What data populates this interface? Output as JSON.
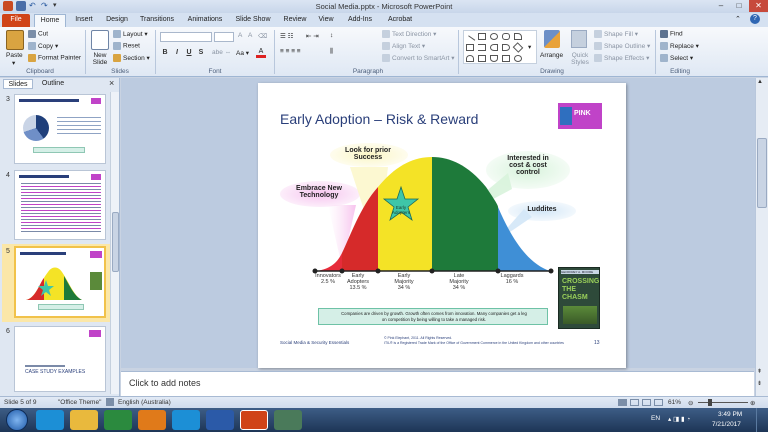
{
  "window": {
    "title": "Social Media.pptx - Microsoft PowerPoint"
  },
  "tabs": [
    "File",
    "Home",
    "Insert",
    "Design",
    "Transitions",
    "Animations",
    "Slide Show",
    "Review",
    "View",
    "Add-Ins",
    "Acrobat"
  ],
  "ribbon": {
    "clipboard": {
      "paste": "Paste",
      "cut": "Cut",
      "copy": "Copy",
      "format_painter": "Format Painter",
      "label": "Clipboard"
    },
    "slides": {
      "new_slide": "New Slide",
      "layout": "Layout",
      "reset": "Reset",
      "section": "Section",
      "label": "Slides"
    },
    "font": {
      "label": "Font",
      "bold": "B",
      "italic": "I",
      "underline": "U",
      "strike": "S"
    },
    "paragraph": {
      "text_direction": "Text Direction",
      "align_text": "Align Text",
      "convert_smartart": "Convert to SmartArt",
      "label": "Paragraph"
    },
    "drawing": {
      "arrange": "Arrange",
      "quick_styles": "Quick Styles",
      "shape_fill": "Shape Fill",
      "shape_outline": "Shape Outline",
      "shape_effects": "Shape Effects",
      "label": "Drawing"
    },
    "editing": {
      "find": "Find",
      "replace": "Replace",
      "select": "Select",
      "label": "Editing"
    }
  },
  "panel": {
    "tab_slides": "Slides",
    "tab_outline": "Outline",
    "close": "×",
    "thumbnails": [
      {
        "num": "3"
      },
      {
        "num": "4"
      },
      {
        "num": "5",
        "selected": true
      },
      {
        "num": "6",
        "title": "CASE STUDY EXAMPLES"
      }
    ]
  },
  "slide": {
    "title": "Early Adoption – Risk & Reward",
    "logo_text": "PINK",
    "callouts": {
      "prior_success": "Look for prior\nSuccess",
      "embrace": "Embrace New\nTechnology",
      "interested": "Interested in\ncost & cost\ncontrol",
      "luddites": "Luddites"
    },
    "star_text": "Early\nAdopters",
    "segments": [
      {
        "name": "Innovators",
        "pct": "2.5 %",
        "color": "#e62c3a"
      },
      {
        "name": "Early\nAdopters",
        "pct": "13.5 %",
        "color": "#d62a2a"
      },
      {
        "name": "Early\nMajority",
        "pct": "34 %",
        "color": "#f4e326"
      },
      {
        "name": "Late\nMajority",
        "pct": "34 %",
        "color": "#1e7a3a"
      },
      {
        "name": "Laggards",
        "pct": "16 %",
        "color": "#3f8fd6"
      }
    ],
    "book": {
      "author": "GEOFFREY A. MOORE",
      "title": "CROSSING THE CHASM"
    },
    "note": "Companies are driven by growth. Growth often comes from innovation. Many companies get a leg\non competition by being willing to take a managed risk.",
    "footer_left": "Social Media & Security Essentials",
    "footer_center": "© Pink Elephant, 2011. All Rights Reserved.\nITIL® is a Registered Trade Mark of the Office of Government Commerce in the United Kingdom and other countries",
    "page_num": "13"
  },
  "notes": {
    "placeholder": "Click to add notes"
  },
  "status": {
    "slide_of": "Slide 5 of 9",
    "theme": "\"Office Theme\"",
    "language": "English (Australia)",
    "zoom": "61%"
  },
  "taskbar": {
    "lang": "EN",
    "time": "3:49 PM",
    "date": "7/21/2017"
  },
  "colors": {
    "accent_file": "#d04418",
    "innovators": "#e62c3a",
    "early_majority": "#f4e326",
    "late_majority": "#1e7a3a",
    "laggards": "#3f8fd6"
  }
}
